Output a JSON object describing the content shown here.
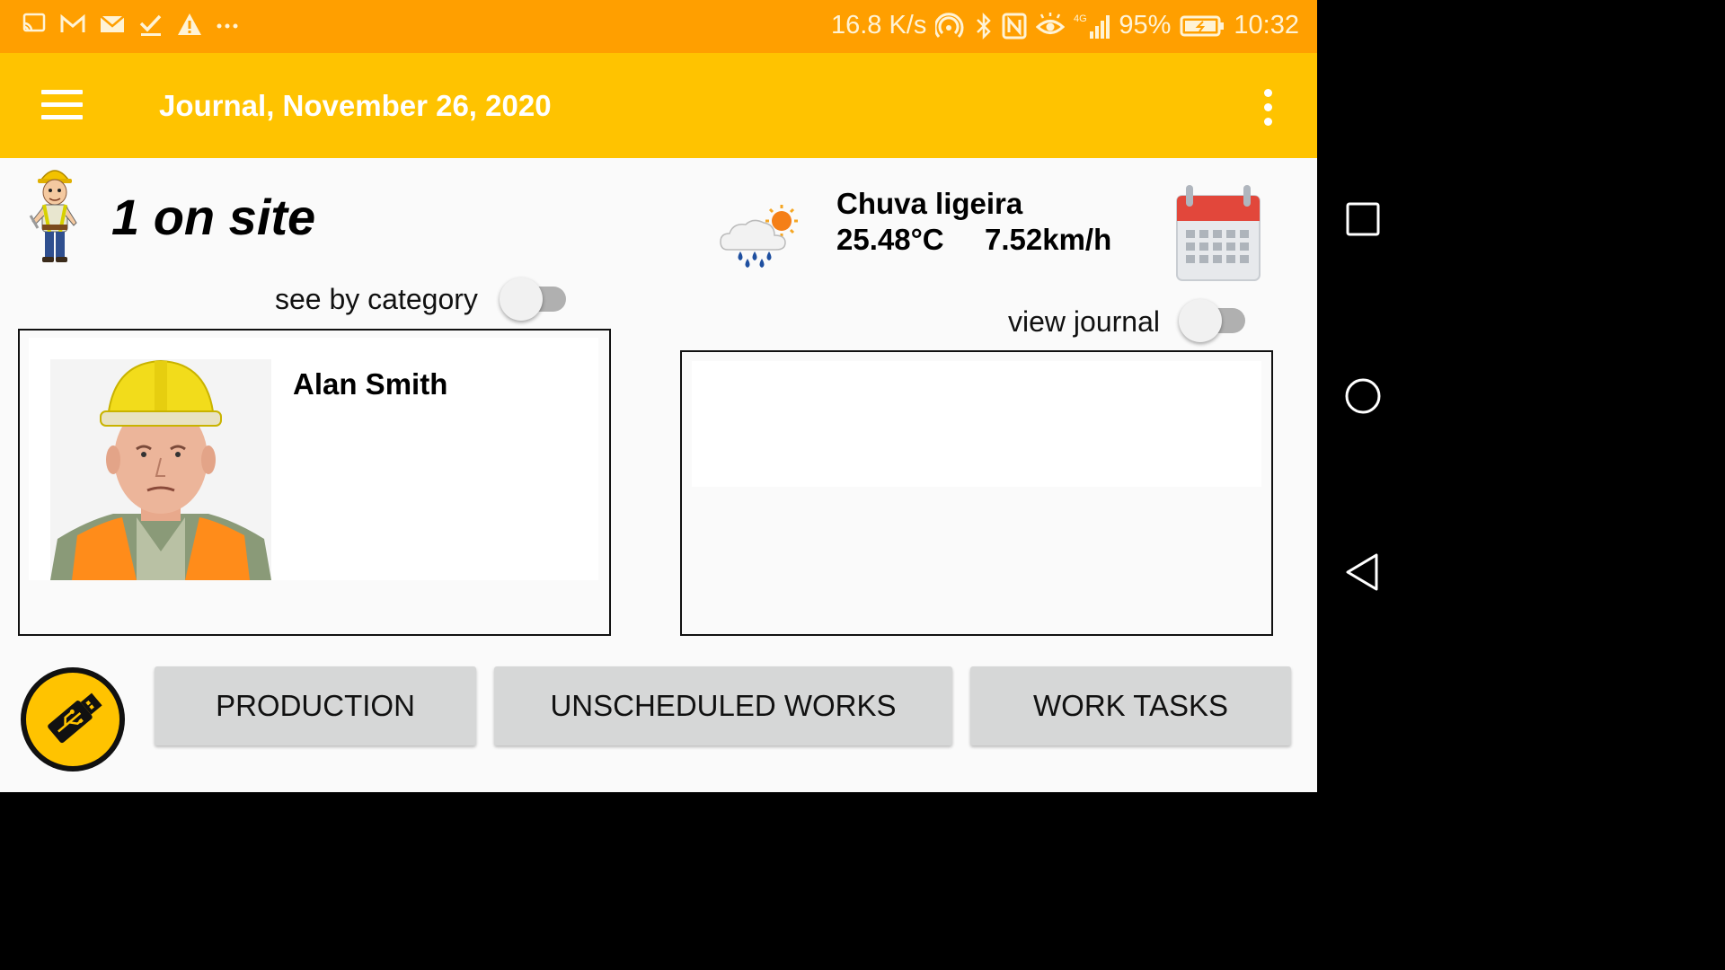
{
  "status_bar": {
    "network_speed": "16.8 K/s",
    "battery": "95%",
    "time": "10:32",
    "network_type": "4G",
    "left_icons": [
      "cast-icon",
      "gmail-icon",
      "mail-icon",
      "check-icon",
      "warning-icon",
      "more-notifications-icon"
    ],
    "right_icons": [
      "hotspot-icon",
      "bluetooth-icon",
      "nfc-icon",
      "eye-comfort-icon",
      "signal-icon",
      "battery-icon"
    ]
  },
  "app_bar": {
    "title": "Journal, November 26, 2020",
    "background": "#FFC300",
    "status_color": "#FF9F00"
  },
  "site": {
    "on_site_label": "1 on site",
    "see_by_category_label": "see by category",
    "see_by_category_on": false
  },
  "workers": [
    {
      "name": "Alan Smith"
    }
  ],
  "weather": {
    "description": "Chuva ligeira",
    "temperature": "25.48°C",
    "wind": "7.52km/h"
  },
  "journal": {
    "view_journal_label": "view journal",
    "view_journal_on": false
  },
  "actions": {
    "production": "PRODUCTION",
    "unscheduled_works": "UNSCHEDULED WORKS",
    "work_tasks": "WORK TASKS"
  },
  "nav_bar": {
    "buttons": [
      "recents-icon",
      "home-icon",
      "back-icon"
    ]
  }
}
